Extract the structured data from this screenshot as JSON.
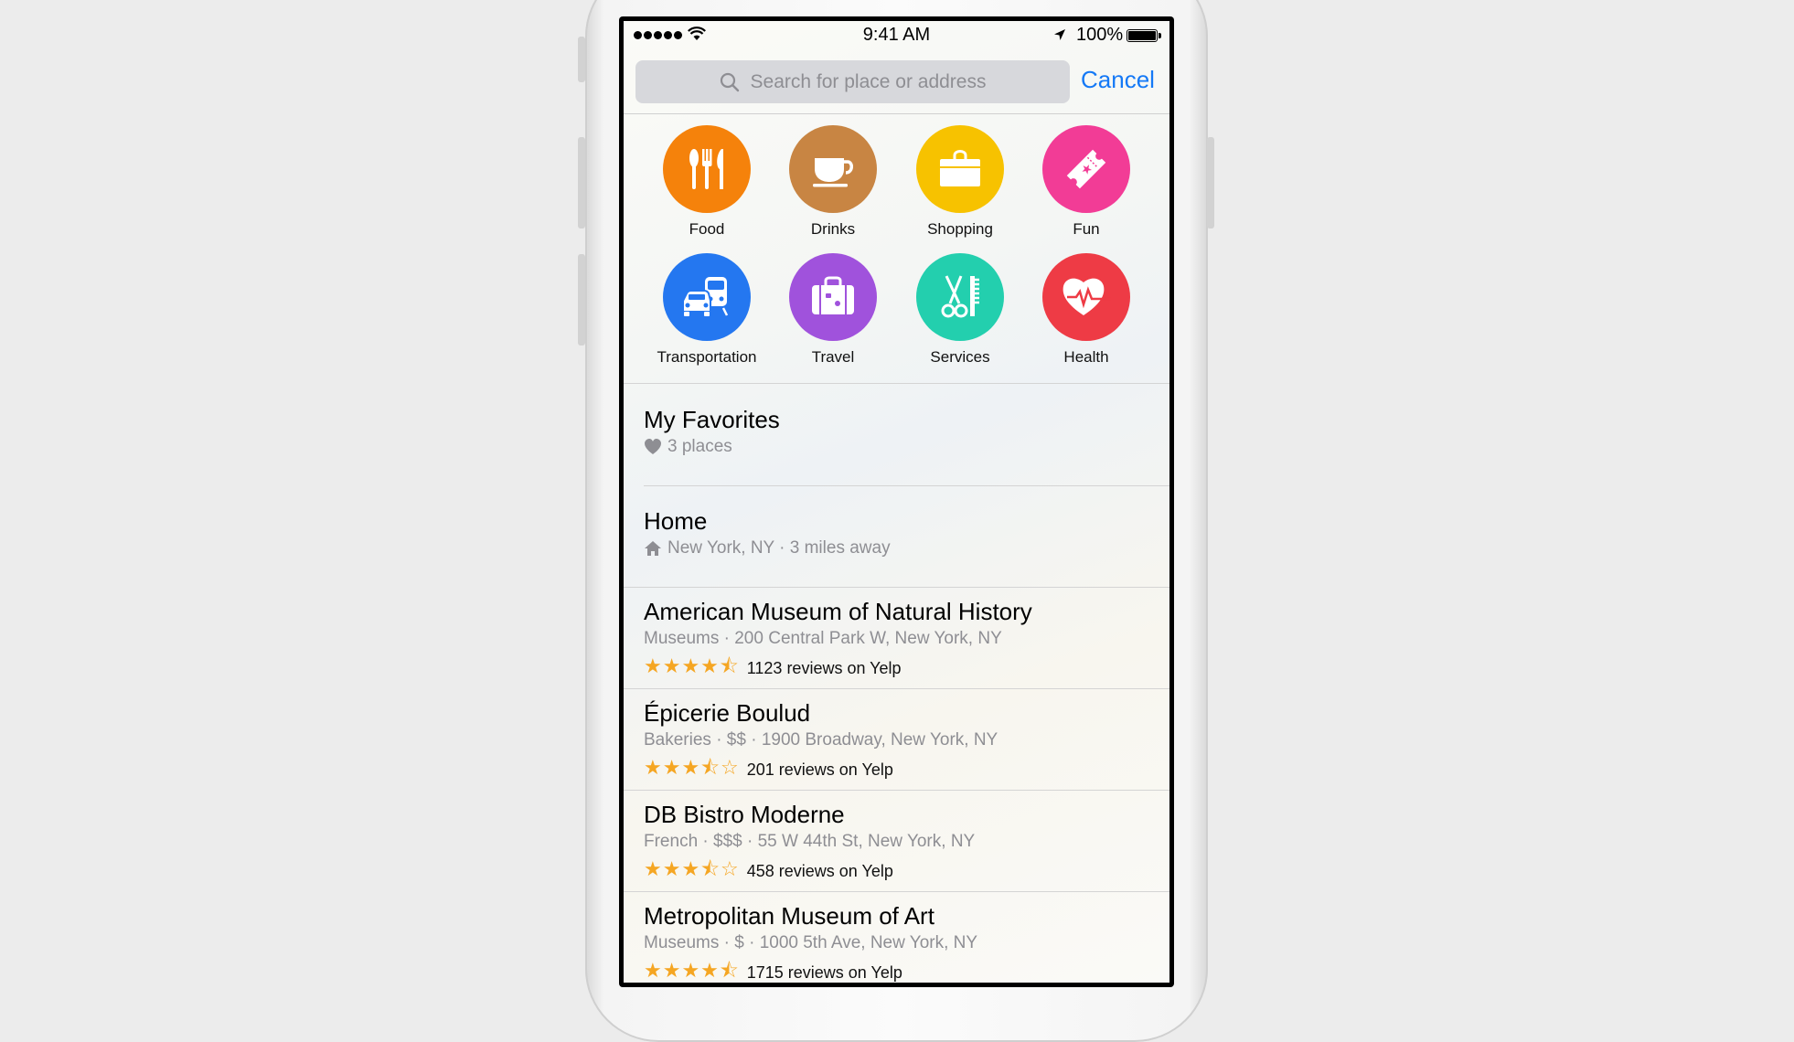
{
  "status_bar": {
    "time": "9:41 AM",
    "battery": "100%"
  },
  "search": {
    "placeholder": "Search for place or address",
    "cancel": "Cancel"
  },
  "colors": {
    "food": "#f5820b",
    "drinks": "#c88543",
    "shopping": "#f7c200",
    "fun": "#f23c96",
    "transportation": "#2477f0",
    "travel": "#a052dc",
    "services": "#23cfae",
    "health": "#ee3b45",
    "accent": "#1479f6",
    "star": "#f5a623"
  },
  "categories": [
    {
      "label": "Food",
      "icon": "fork-knife-icon"
    },
    {
      "label": "Drinks",
      "icon": "coffee-cup-icon"
    },
    {
      "label": "Shopping",
      "icon": "shopping-bag-icon"
    },
    {
      "label": "Fun",
      "icon": "ticket-icon"
    },
    {
      "label": "Transportation",
      "icon": "car-train-icon"
    },
    {
      "label": "Travel",
      "icon": "suitcase-icon"
    },
    {
      "label": "Services",
      "icon": "scissors-comb-icon"
    },
    {
      "label": "Health",
      "icon": "heart-pulse-icon"
    }
  ],
  "favorites": {
    "title": "My Favorites",
    "subtitle": "3 places"
  },
  "home": {
    "title": "Home",
    "subtitle": "New York, NY · 3 miles away"
  },
  "places": [
    {
      "name": "American Museum of Natural History",
      "details": "Museums · 200 Central Park W, New York, NY",
      "stars": "★★★★⯪",
      "rating": 4.5,
      "reviews": "1123 reviews on Yelp"
    },
    {
      "name": "Épicerie Boulud",
      "details": "Bakeries · $$ · 1900 Broadway, New York, NY",
      "stars": "★★★⯪☆",
      "rating": 3.5,
      "reviews": "201 reviews on Yelp"
    },
    {
      "name": "DB Bistro Moderne",
      "details": "French · $$$ · 55 W 44th St, New York, NY",
      "stars": "★★★⯪☆",
      "rating": 3.5,
      "reviews": "458 reviews on Yelp"
    },
    {
      "name": "Metropolitan Museum of Art",
      "details": "Museums · $ · 1000 5th Ave, New York, NY",
      "stars": "★★★★⯪",
      "rating": 4.5,
      "reviews": "1715 reviews on Yelp"
    }
  ]
}
